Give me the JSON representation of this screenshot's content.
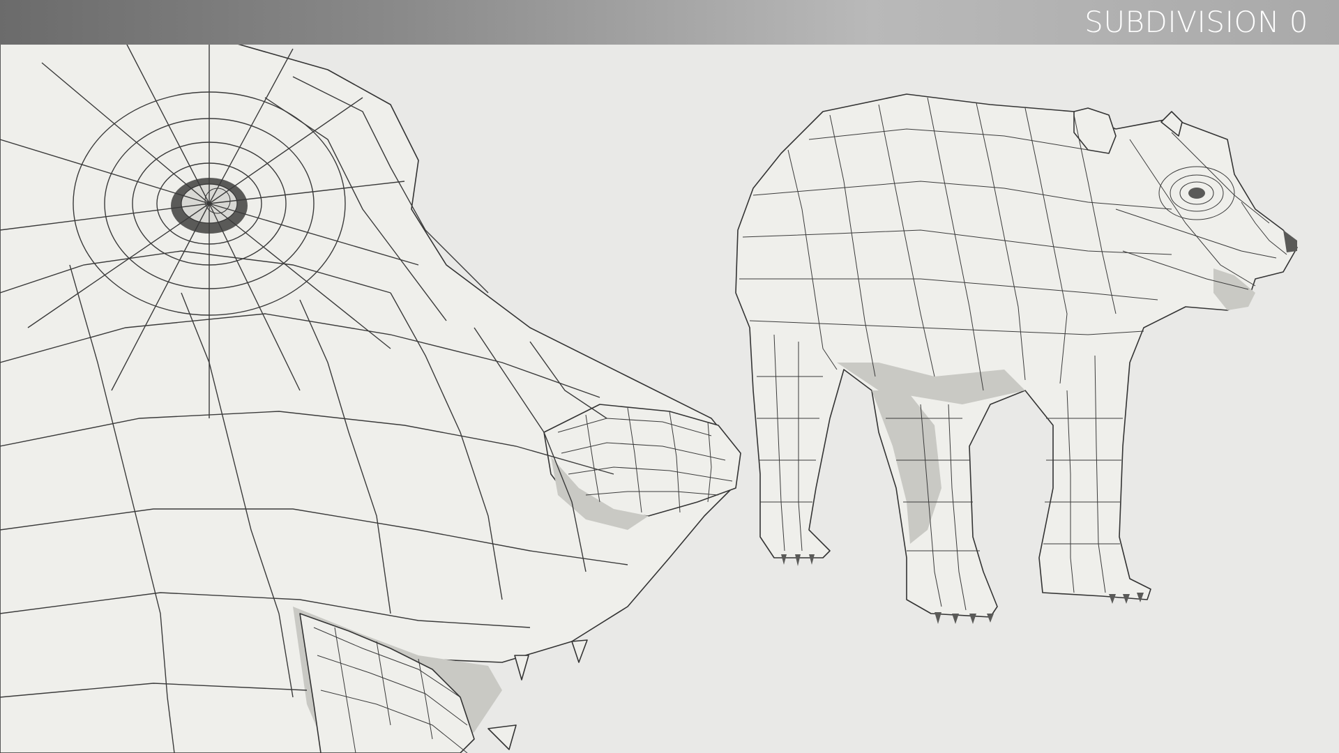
{
  "header": {
    "label": "SUBDIVISION 0"
  },
  "colors": {
    "background": "#e9e9e7",
    "mesh_fill": "#efefeb",
    "wire": "#3a3a3a",
    "bar_dark": "#6b6b6b",
    "bar_light": "#b9b9b9",
    "label": "#ffffff"
  },
  "views": {
    "closeup": "bear-head-closeup-wireframe",
    "full_body": "bear-full-body-wireframe"
  }
}
